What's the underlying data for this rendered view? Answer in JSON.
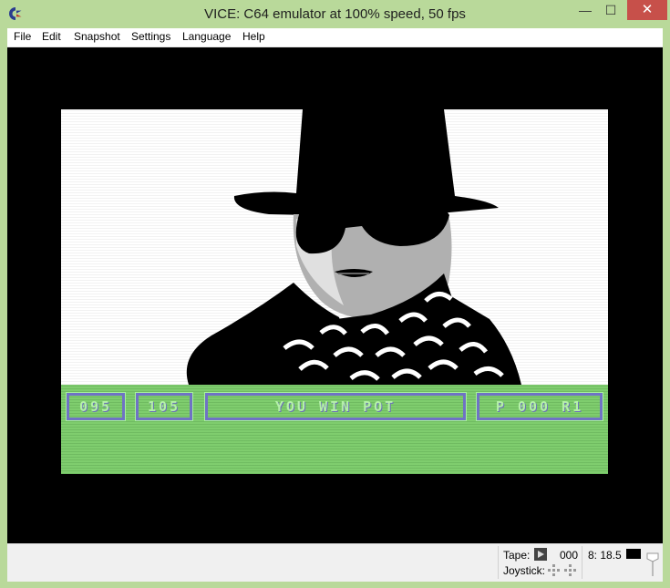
{
  "window": {
    "title": "VICE: C64 emulator at 100% speed, 50 fps",
    "controls": {
      "minimize": "—",
      "maximize": "☐",
      "close": "✕"
    }
  },
  "menu": {
    "items": [
      "File",
      "Edit",
      "Snapshot",
      "Settings",
      "Language",
      "Help"
    ]
  },
  "game": {
    "box1": "095",
    "box2": "105",
    "message": "YOU WIN  POT",
    "box4": "P 000 R1",
    "colors": {
      "display_bg": "#ffffff",
      "status_bg": "#7fcd6e",
      "box_border": "#6f73c4",
      "box_text": "#b4f0a8"
    }
  },
  "status": {
    "tape_label": "Tape:",
    "tape_counter": "000",
    "drive_label": "8: 18.5",
    "joystick_label": "Joystick:"
  }
}
